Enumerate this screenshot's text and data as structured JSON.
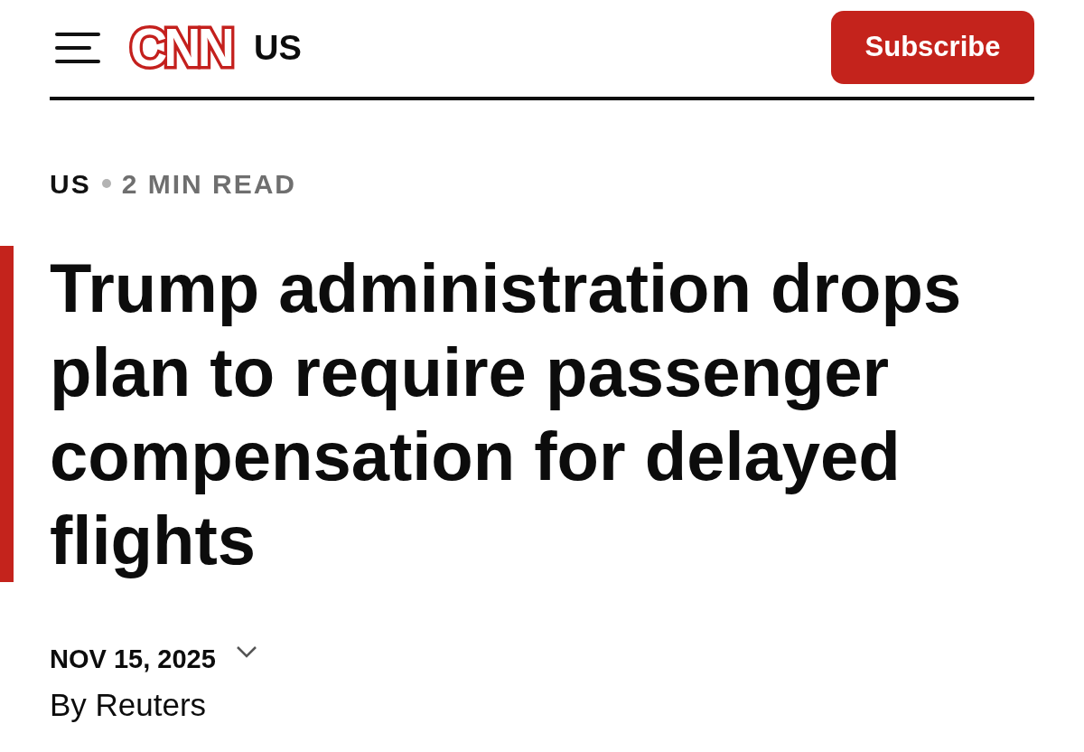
{
  "header": {
    "logo": "CNN",
    "edition": "US",
    "subscribe_button": "Subscribe"
  },
  "article": {
    "section": "US",
    "read_time": "2 MIN READ",
    "headline": "Trump administration drops plan to require passenger compensation for delayed flights",
    "date": "NOV 15, 2025",
    "date_menu": {
      "expanded": false
    },
    "byline": "By Reuters"
  }
}
